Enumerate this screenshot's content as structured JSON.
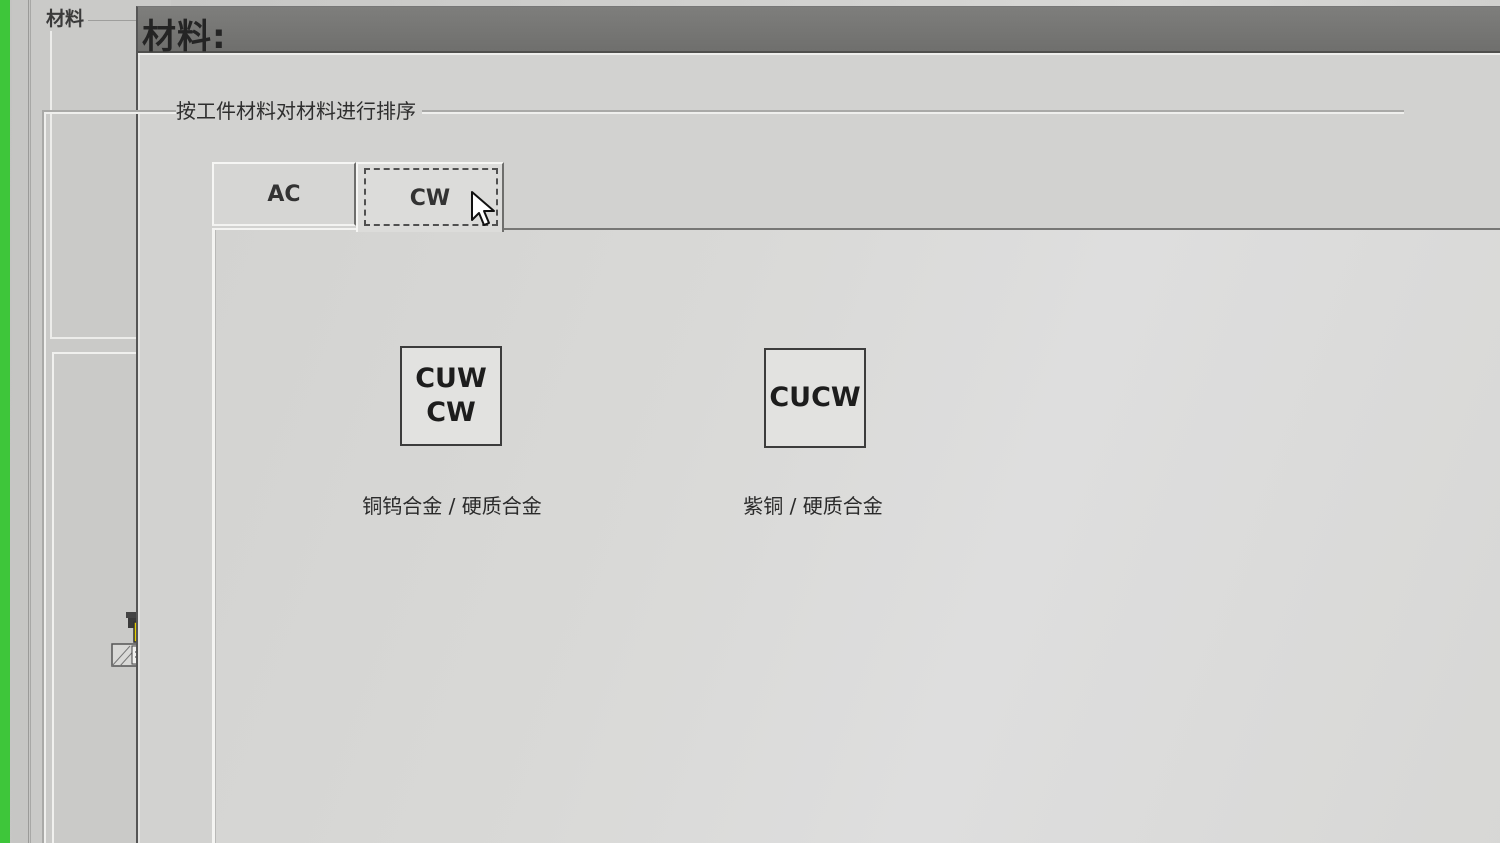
{
  "background_window": {
    "title": "材料"
  },
  "dialog": {
    "title": "材料:",
    "group_label": "按工件材料对材料进行排序"
  },
  "tabs": [
    {
      "label": "AC",
      "selected": false
    },
    {
      "label": "CW",
      "selected": true
    }
  ],
  "materials": [
    {
      "line1": "CUW",
      "line2": "CW",
      "caption": "铜钨合金 / 硬质合金"
    },
    {
      "line1": "CUCW",
      "line2": "",
      "caption": "紫铜 / 硬质合金"
    }
  ],
  "colors": {
    "accent_green": "#3ec63a",
    "titlebar": "#7e7e7c",
    "panel": "#d2d2d0"
  },
  "icons": {
    "cursor": "mouse-pointer-icon",
    "tool": "tool-holder-icon"
  }
}
